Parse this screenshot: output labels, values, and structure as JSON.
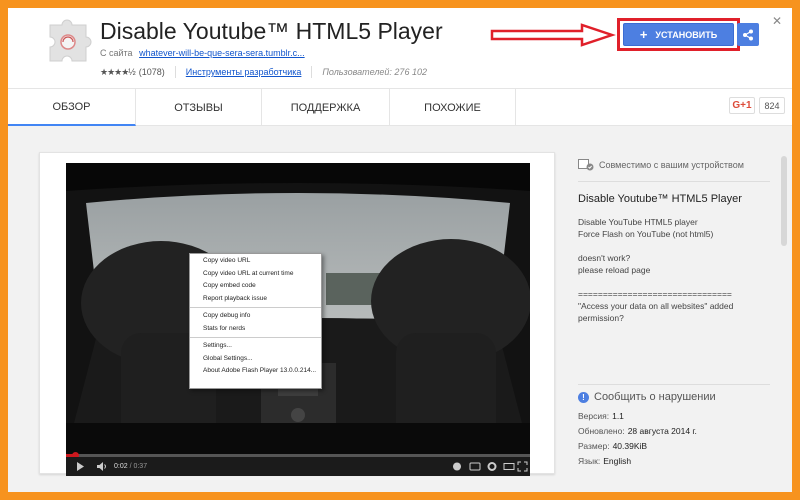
{
  "header": {
    "title": "Disable Youtube™ HTML5 Player",
    "from_label": "С сайта",
    "site": "whatever-will-be-que-sera-sera.tumblr.c...",
    "stars": "★★★★½",
    "rating_count": "(1078)",
    "category": "Инструменты разработчика",
    "users": "Пользователей: 276 102",
    "install_label": "УСТАНОВИТЬ",
    "close_glyph": "✕"
  },
  "tabs": [
    {
      "label": "ОБЗОР"
    },
    {
      "label": "ОТЗЫВЫ"
    },
    {
      "label": "ПОДДЕРЖКА"
    },
    {
      "label": "ПОХОЖИЕ"
    }
  ],
  "social": {
    "gplus_label": "G+1",
    "count": "824"
  },
  "video": {
    "current_time": "0:02",
    "duration": "/ 0:37",
    "progress_fraction": 0.02,
    "context_menu": {
      "group1": [
        "Copy video URL",
        "Copy video URL at current time",
        "Copy embed code",
        "Report playback issue"
      ],
      "group2": [
        "Copy debug info",
        "Stats for nerds"
      ],
      "group3": [
        "Settings...",
        "Global Settings...",
        "About Adobe Flash Player 13.0.0.214..."
      ]
    }
  },
  "sidebar": {
    "compat": "Совместимо с вашим устройством",
    "name": "Disable Youtube™ HTML5 Player",
    "description": "Disable YouTube HTML5 player\nForce Flash on YouTube (not html5)\n\ndoesn't work?\nplease reload page\n\n===============================\n\"Access your data on all websites\" added permission?",
    "report": "Сообщить о нарушении",
    "details": [
      {
        "label": "Версия:",
        "value": "1.1"
      },
      {
        "label": "Обновлено:",
        "value": "28 августа 2014 г."
      },
      {
        "label": "Размер:",
        "value": "40.39KiB"
      },
      {
        "label": "Язык:",
        "value": "English"
      }
    ]
  },
  "colors": {
    "accent": "#4d7fe1",
    "frame": "#f7931e",
    "highlight": "#e0202a",
    "progress": "#cc181e"
  }
}
